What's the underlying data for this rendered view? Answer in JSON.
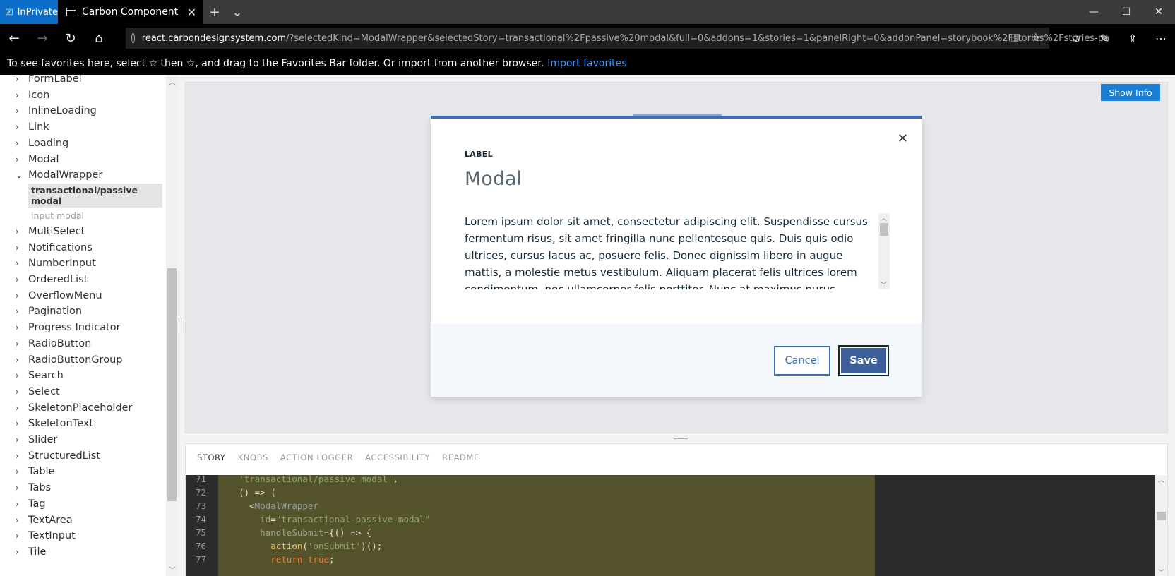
{
  "browser": {
    "inprivate_label": "InPrivate",
    "tab_title": "Carbon Components React",
    "url_host": "react.carbondesignsystem.com",
    "url_rest": "/?selectedKind=ModalWrapper&selectedStory=transactional%2Fpassive%20modal&full=0&addons=1&stories=1&panelRight=0&addonPanel=storybook%2Fstories%2Fstories-pa",
    "favorites_message": "To see favorites here, select ☆ then ☆, and drag to the Favorites Bar folder. Or import from another browser.",
    "favorites_link": "Import favorites"
  },
  "sidebar": {
    "items": [
      {
        "label": "FormLabel",
        "chev": "›"
      },
      {
        "label": "Icon",
        "chev": "›"
      },
      {
        "label": "InlineLoading",
        "chev": "›"
      },
      {
        "label": "Link",
        "chev": "›"
      },
      {
        "label": "Loading",
        "chev": "›"
      },
      {
        "label": "Modal",
        "chev": "›"
      },
      {
        "label": "ModalWrapper",
        "chev": "⌄"
      }
    ],
    "stories": [
      {
        "label": "transactional/passive modal",
        "active": true
      },
      {
        "label": "input modal",
        "active": false
      }
    ],
    "items_after": [
      {
        "label": "MultiSelect"
      },
      {
        "label": "Notifications"
      },
      {
        "label": "NumberInput"
      },
      {
        "label": "OrderedList"
      },
      {
        "label": "OverflowMenu"
      },
      {
        "label": "Pagination"
      },
      {
        "label": "Progress Indicator"
      },
      {
        "label": "RadioButton"
      },
      {
        "label": "RadioButtonGroup"
      },
      {
        "label": "Search"
      },
      {
        "label": "Select"
      },
      {
        "label": "SkeletonPlaceholder"
      },
      {
        "label": "SkeletonText"
      },
      {
        "label": "Slider"
      },
      {
        "label": "StructuredList"
      },
      {
        "label": "Table"
      },
      {
        "label": "Tabs"
      },
      {
        "label": "Tag"
      },
      {
        "label": "TextArea"
      },
      {
        "label": "TextInput"
      },
      {
        "label": "Tile"
      }
    ]
  },
  "preview": {
    "show_info": "Show Info"
  },
  "modal": {
    "label": "LABEL",
    "heading": "Modal",
    "content": "Lorem ipsum dolor sit amet, consectetur adipiscing elit. Suspendisse cursus fermentum risus, sit amet fringilla nunc pellentesque quis. Duis quis odio ultrices, cursus lacus ac, posuere felis. Donec dignissim libero in augue mattis, a molestie metus vestibulum. Aliquam placerat felis ultrices lorem condimentum, nec ullamcorper felis porttitor. Nunc at maximus purus. Curabitur sodales eros sit",
    "cancel": "Cancel",
    "save": "Save"
  },
  "panel": {
    "tabs": [
      {
        "label": "STORY",
        "active": true
      },
      {
        "label": "KNOBS",
        "active": false
      },
      {
        "label": "ACTION LOGGER",
        "active": false
      },
      {
        "label": "ACCESSIBILITY",
        "active": false
      },
      {
        "label": "README",
        "active": false
      }
    ],
    "code": [
      {
        "n": "71",
        "tokens": [
          [
            "s",
            "'transactional/passive modal'"
          ],
          [
            "p",
            ","
          ]
        ],
        "indent": "  "
      },
      {
        "n": "72",
        "tokens": [
          [
            "p",
            "() => ("
          ]
        ],
        "indent": "  "
      },
      {
        "n": "73",
        "tokens": [
          [
            "p",
            "<"
          ],
          [
            "t",
            "ModalWrapper"
          ]
        ],
        "indent": "    "
      },
      {
        "n": "74",
        "tokens": [
          [
            "a",
            "id"
          ],
          [
            "p",
            "="
          ],
          [
            "s",
            "\"transactional-passive-modal\""
          ]
        ],
        "indent": "      "
      },
      {
        "n": "75",
        "tokens": [
          [
            "a",
            "handleSubmit"
          ],
          [
            "p",
            "={() => {"
          ]
        ],
        "indent": "      "
      },
      {
        "n": "76",
        "tokens": [
          [
            "f",
            "action"
          ],
          [
            "p",
            "("
          ],
          [
            "s",
            "'onSubmit'"
          ],
          [
            "p",
            ")();"
          ]
        ],
        "indent": "        "
      },
      {
        "n": "77",
        "tokens": [
          [
            "k",
            "return"
          ],
          [
            "p",
            " "
          ],
          [
            "k",
            "true"
          ],
          [
            "p",
            ";"
          ]
        ],
        "indent": "        "
      }
    ]
  }
}
